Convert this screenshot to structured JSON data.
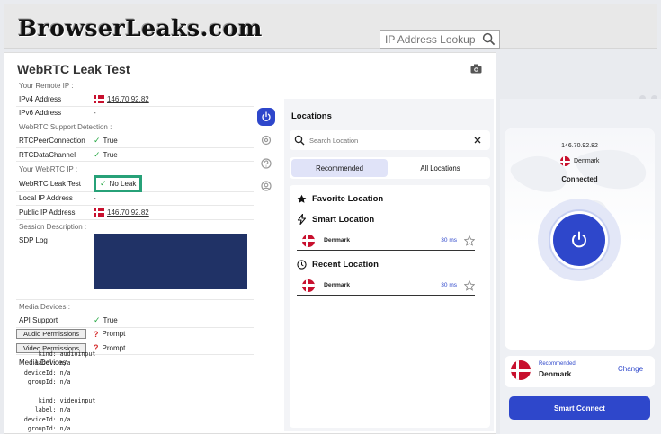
{
  "site": {
    "logo": "BrowserLeaks.com",
    "search_placeholder": "IP Address Lookup"
  },
  "page": {
    "title": "WebRTC Leak Test",
    "sections": {
      "remote_ip": "Your Remote IP :",
      "support": "WebRTC Support Detection :",
      "webrtc_ip": "Your WebRTC IP :",
      "sdp": "Session Description :",
      "media": "Media Devices :"
    },
    "rows": {
      "ipv4": {
        "label": "IPv4 Address",
        "value": "146.70.92.82"
      },
      "ipv6": {
        "label": "IPv6 Address",
        "value": "-"
      },
      "rtcpc": {
        "label": "RTCPeerConnection",
        "value": "True"
      },
      "rtcdc": {
        "label": "RTCDataChannel",
        "value": "True"
      },
      "leak": {
        "label": "WebRTC Leak Test",
        "value": "No Leak"
      },
      "local": {
        "label": "Local IP Address",
        "value": "-"
      },
      "public": {
        "label": "Public IP Address",
        "value": "146.70.92.82"
      },
      "sdp": {
        "label": "SDP Log"
      },
      "api": {
        "label": "API Support",
        "value": "True"
      },
      "audio": {
        "button": "Audio Permissions",
        "value": "Prompt"
      },
      "video": {
        "button": "Video Permissions",
        "value": "Prompt"
      },
      "devices": {
        "label": "Media Devices"
      }
    },
    "media_dump": "       kind: audioinput\n      label: n/a\n   deviceId: n/a\n    groupId: n/a\n\n       kind: videoinput\n      label: n/a\n   deviceId: n/a\n    groupId: n/a"
  },
  "vpn": {
    "locations": {
      "title": "Locations",
      "search_placeholder": "Search Location",
      "tabs": [
        "Recommended",
        "All Locations"
      ],
      "favorite": "Favorite Location",
      "smart": "Smart Location",
      "recent": "Recent Location",
      "smart_item": {
        "name": "Denmark",
        "ping": "30 ms"
      },
      "recent_item": {
        "name": "Denmark",
        "ping": "30 ms"
      }
    },
    "status": {
      "ip": "146.70.92.82",
      "country": "Denmark",
      "state": "Connected"
    },
    "recommended": {
      "label": "Recommended",
      "country": "Denmark",
      "change": "Change"
    },
    "smart_connect": "Smart Connect",
    "accent": "#2e47cb"
  }
}
